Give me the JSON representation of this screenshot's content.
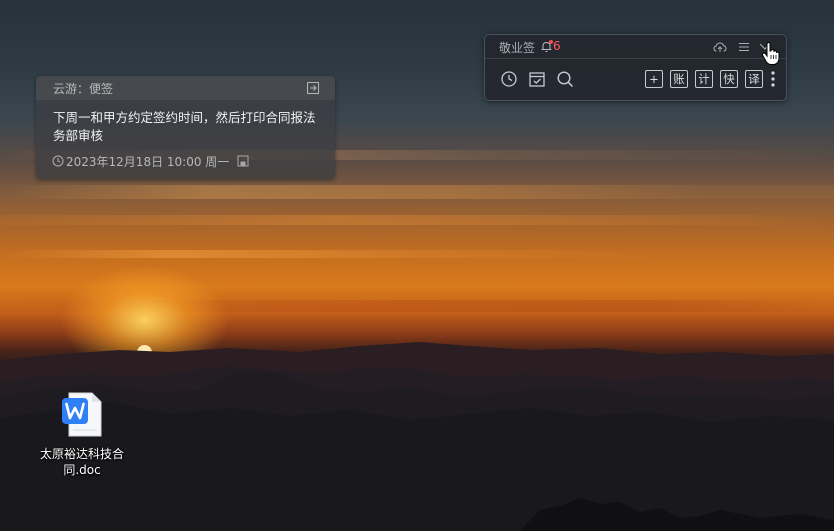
{
  "sticky_note": {
    "title": "云游：便签",
    "content": "下周一和甲方约定签约时间，然后打印合同报法务部审核",
    "datetime": "2023年12月18日  10:00 周一",
    "exit_icon": "exit-icon",
    "clock_icon": "clock-icon",
    "save_icon": "save-icon"
  },
  "widget": {
    "title": "敬业签",
    "notification_count": "6",
    "header_icons": [
      "bell-icon",
      "cloud-upload-icon",
      "menu-icon",
      "collapse-icon"
    ],
    "toolbar": {
      "left_icons": [
        "clock-icon",
        "calendar-check-icon",
        "search-icon"
      ],
      "add_label": "+",
      "account_label": "账",
      "count_label": "计",
      "fast_label": "快",
      "translate_label": "译",
      "more_icon": "more-vertical-icon"
    },
    "accent_color": "#ff5a5a"
  },
  "desktop": {
    "file_name": "太原裕达科技合同.doc",
    "file_icon": "wps-word-document-icon"
  }
}
